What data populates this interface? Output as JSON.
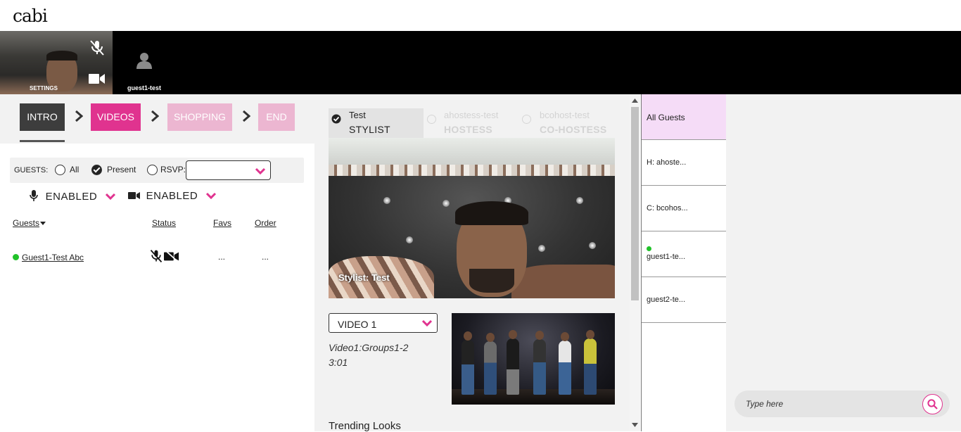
{
  "app": {
    "logo": "cabi"
  },
  "video_bar": {
    "self_tile": {
      "label": "SETTINGS",
      "mic_icon": "mic-off-icon",
      "camera_icon": "video-camera-icon"
    },
    "guest_tile": {
      "name": "guest1-test",
      "icon": "user-avatar-icon"
    }
  },
  "steps": [
    {
      "label": "INTRO",
      "state": "active",
      "color": "#3d3d3d"
    },
    {
      "label": "VIDEOS",
      "state": "current",
      "color": "#e0338f"
    },
    {
      "label": "SHOPPING",
      "state": "pending",
      "color": "#ecb6d1"
    },
    {
      "label": "END",
      "state": "pending",
      "color": "#ecb6d1"
    }
  ],
  "guest_filter": {
    "label": "GUESTS:",
    "options": [
      {
        "label": "All",
        "checked": false
      },
      {
        "label": "Present",
        "checked": true
      },
      {
        "label": "RSVP:",
        "checked": false
      }
    ],
    "rsvp_value": ""
  },
  "media_controls": {
    "mic": {
      "label": "ENABLED",
      "icon": "microphone-icon"
    },
    "camera": {
      "label": "ENABLED",
      "icon": "video-camera-icon"
    }
  },
  "guest_table": {
    "columns": [
      "Guests",
      "Status",
      "Favs",
      "Order"
    ],
    "rows": [
      {
        "name": "Guest1-Test Abc",
        "online": true,
        "status_icons": [
          "mic-off-icon",
          "video-off-icon"
        ],
        "favs": "...",
        "order": "..."
      }
    ]
  },
  "role_tabs": [
    {
      "name": "Test",
      "role": "STYLIST",
      "selected": true
    },
    {
      "name": "ahostess-test",
      "role": "HOSTESS",
      "selected": false
    },
    {
      "name": "bcohost-test",
      "role": "CO-HOSTESS",
      "selected": false
    }
  ],
  "main_video": {
    "caption": "Stylist: Test"
  },
  "video_select": {
    "value": "VIDEO 1"
  },
  "video_info": {
    "title": "Video1:Groups1-2",
    "duration": "3:01"
  },
  "trending": {
    "heading": "Trending Looks"
  },
  "guest_list": [
    {
      "label": "All Guests",
      "selected": true,
      "online": false
    },
    {
      "label": "H: ahoste...",
      "selected": false,
      "online": false
    },
    {
      "label": "C: bcohos...",
      "selected": false,
      "online": false
    },
    {
      "label": "guest1-te...",
      "selected": false,
      "online": true
    },
    {
      "label": "guest2-te...",
      "selected": false,
      "online": false
    }
  ],
  "chat": {
    "placeholder": "Type here",
    "send_icon": "search-icon"
  },
  "colors": {
    "brand_pink": "#e0338f",
    "online_green": "#21c22a"
  }
}
